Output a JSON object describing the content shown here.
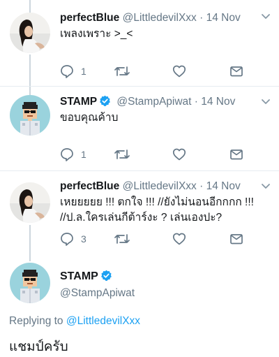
{
  "tweets": [
    {
      "name": "perfectBlue",
      "handle": "@LittledevilXxx",
      "date": "· 14 Nov",
      "text": "เพลงเพราะ >_<",
      "reply_count": "1",
      "avatar": "girl-avatar"
    },
    {
      "name": "STAMP",
      "handle": "@StampApiwat",
      "date": "· 14 Nov",
      "text": "ขอบคุณค้าบ",
      "reply_count": "1",
      "verified": true,
      "avatar": "pixel-man-avatar"
    },
    {
      "name": "perfectBlue",
      "handle": "@LittledevilXxx",
      "date": "· 14 Nov",
      "text": "เหยยยยย !!! ตกใจ !!! //ยังไม่นอนอีกกกก !!! //ป.ล.ใครเล่นกีต้าร์งะ ? เล่นเองปะ?",
      "reply_count": "3",
      "avatar": "girl-avatar"
    }
  ],
  "main_tweet": {
    "name": "STAMP",
    "handle": "@StampApiwat",
    "replying_prefix": "Replying to",
    "replying_mention": "@LittledevilXxx",
    "text": "แชมป์ครับ",
    "verified": true
  },
  "icons": {
    "reply": "reply-icon",
    "retweet": "retweet-icon",
    "like": "like-icon",
    "dm": "direct-message-icon",
    "more": "chevron-down-icon"
  },
  "colors": {
    "verified": "#1da1f2",
    "link": "#1da1f2",
    "muted": "#657786",
    "thread_line": "#ccd6dd"
  }
}
